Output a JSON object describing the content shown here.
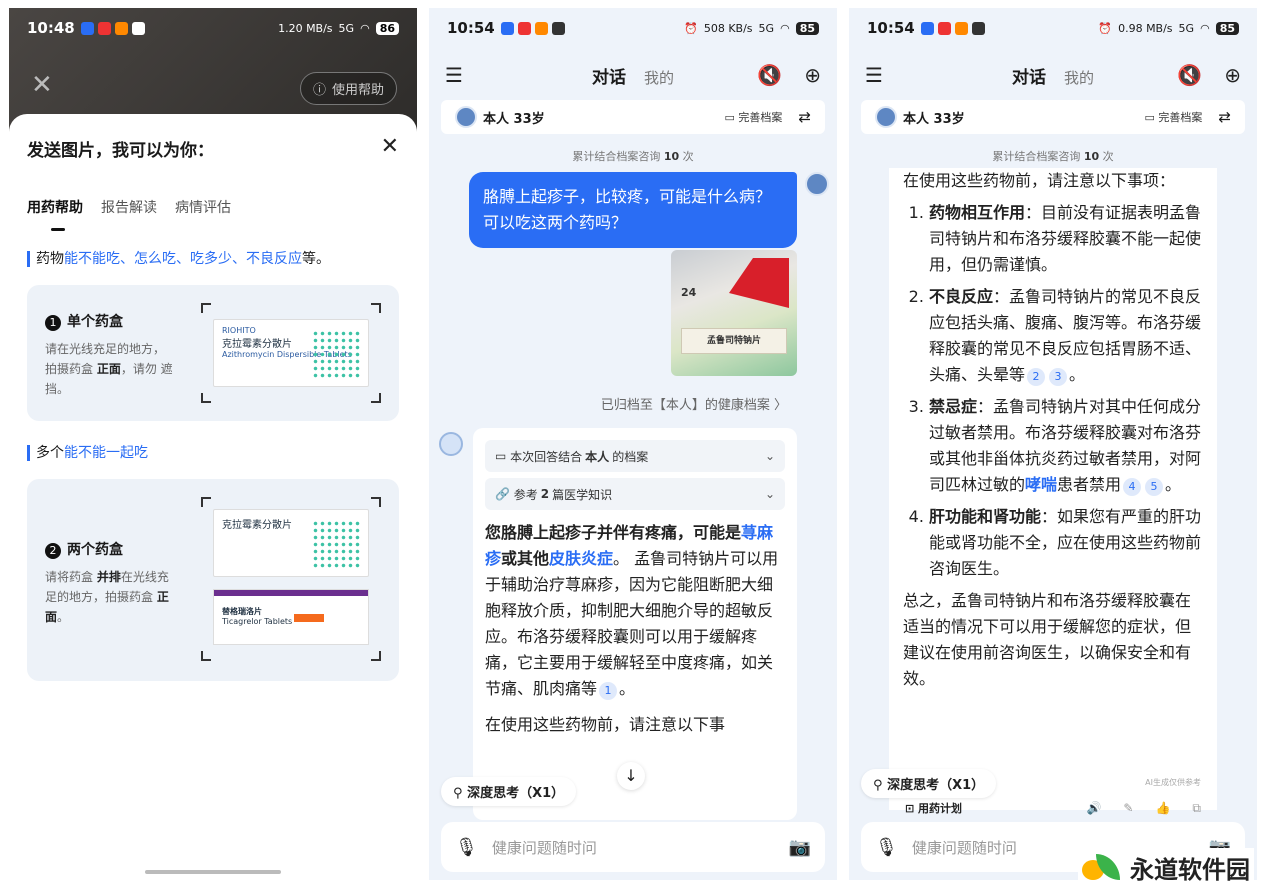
{
  "panel1": {
    "status": {
      "time": "10:48",
      "net": "1.20 MB/s",
      "battery": "86"
    },
    "help_button": "使用帮助",
    "sheet_title": "发送图片，我可以为你：",
    "tabs": [
      "用药帮助",
      "报告解读",
      "病情评估"
    ],
    "intro": {
      "prefix": "药物",
      "highlight": "能不能吃、怎么吃、吃多少、不良反应",
      "suffix": "等。"
    },
    "card1": {
      "num": "1",
      "title": "单个药盒",
      "desc_a": "请在光线充足的地方，拍摄药盒 ",
      "desc_bold": "正面",
      "desc_b": "，请勿 遮挡。",
      "box_brand": "RIOHITO",
      "box_name": "克拉霉素分散片",
      "box_en": "Azithromycin Dispersible Tablets"
    },
    "section2": {
      "prefix": "多个",
      "highlight": "能不能一起吃"
    },
    "card2": {
      "num": "2",
      "title": "两个药盒",
      "desc_a": "请将药盒 ",
      "desc_bold1": "并排",
      "desc_b": "在光线充足的地方，拍摄药盒 ",
      "desc_bold2": "正面",
      "desc_c": "。",
      "box_name": "克拉霉素分散片",
      "box2_name": "替格瑞洛片",
      "box2_en": "Ticagrelor Tablets"
    }
  },
  "panel2": {
    "status": {
      "time": "10:54",
      "net": "508 KB/s",
      "battery": "85"
    },
    "nav_active": "对话",
    "nav_inactive": "我的",
    "profile": {
      "name": "本人 33岁",
      "complete": "完善档案"
    },
    "count": {
      "prefix": "累计结合档案咨询 ",
      "num": "10",
      "suffix": " 次"
    },
    "user_msg": "胳膊上起疹子，比较疼，可能是什么病？可以吃这两个药吗？",
    "image_label": "孟鲁司特钠片",
    "image_num": "24",
    "archived": "已归档至【本人】的健康档案 〉",
    "ref1": {
      "a": "本次回答结合 ",
      "b": "本人",
      "c": " 的档案"
    },
    "ref2": {
      "a": "参考 ",
      "b": "2",
      "c": " 篇医学知识"
    },
    "ans_bold": "您胳膊上起疹子并伴有疼痛，可能是",
    "ans_link1": "荨麻疹",
    "ans_mid": "或其他",
    "ans_link2": "皮肤炎症",
    "ans_body": "。 孟鲁司特钠片可以用于辅助治疗荨麻疹，因为它能阻断肥大细胞释放介质，抑制肥大细胞介导的超敏反应。布洛芬缓释胶囊则可以用于缓解疼痛，它主要用于缓解轻至中度疼痛，如关节痛、肌肉痛等",
    "cite1": "1",
    "ans_tail": "在使用这些药物前，请注意以下事",
    "deep": "深度思考（X1）",
    "input_placeholder": "健康问题随时问"
  },
  "panel3": {
    "status": {
      "time": "10:54",
      "net": "0.98 MB/s",
      "battery": "85"
    },
    "nav_active": "对话",
    "nav_inactive": "我的",
    "profile": {
      "name": "本人 33岁",
      "complete": "完善档案"
    },
    "count": {
      "prefix": "累计结合档案咨询 ",
      "num": "10",
      "suffix": " 次"
    },
    "lead": "在使用这些药物前，请注意以下事项：",
    "items": [
      {
        "title": "药物相互作用",
        "text": "：目前没有证据表明孟鲁司特钠片和布洛芬缓释胶囊不能一起使用，但仍需谨慎。"
      },
      {
        "title": "不良反应",
        "text": "：孟鲁司特钠片的常见不良反应包括头痛、腹痛、腹泻等。布洛芬缓释胶囊的常见不良反应包括胃肠不适、头痛、头晕等",
        "cites": [
          "2",
          "3"
        ]
      },
      {
        "title": "禁忌症",
        "text": "：孟鲁司特钠片对其中任何成分过敏者禁用。布洛芬缓释胶囊对布洛芬或其他非甾体抗炎药过敏者禁用，对阿司匹林过敏的",
        "link": "哮喘",
        "text2": "患者禁用",
        "cites": [
          "4",
          "5"
        ]
      },
      {
        "title": "肝功能和肾功能",
        "text": "：如果您有严重的肝功能或肾功能不全，应在使用这些药物前咨询医生。"
      }
    ],
    "summary": "总之，孟鲁司特钠片和布洛芬缓释胶囊在适当的情况下可以用于缓解您的症状，但建议在使用前咨询医生，以确保安全和有效。",
    "ai_note": "AI生成仅供参考",
    "plan": "用药计划",
    "deep": "深度思考（X1）",
    "input_placeholder": "健康问题随时问"
  },
  "watermark": "永道软件园"
}
